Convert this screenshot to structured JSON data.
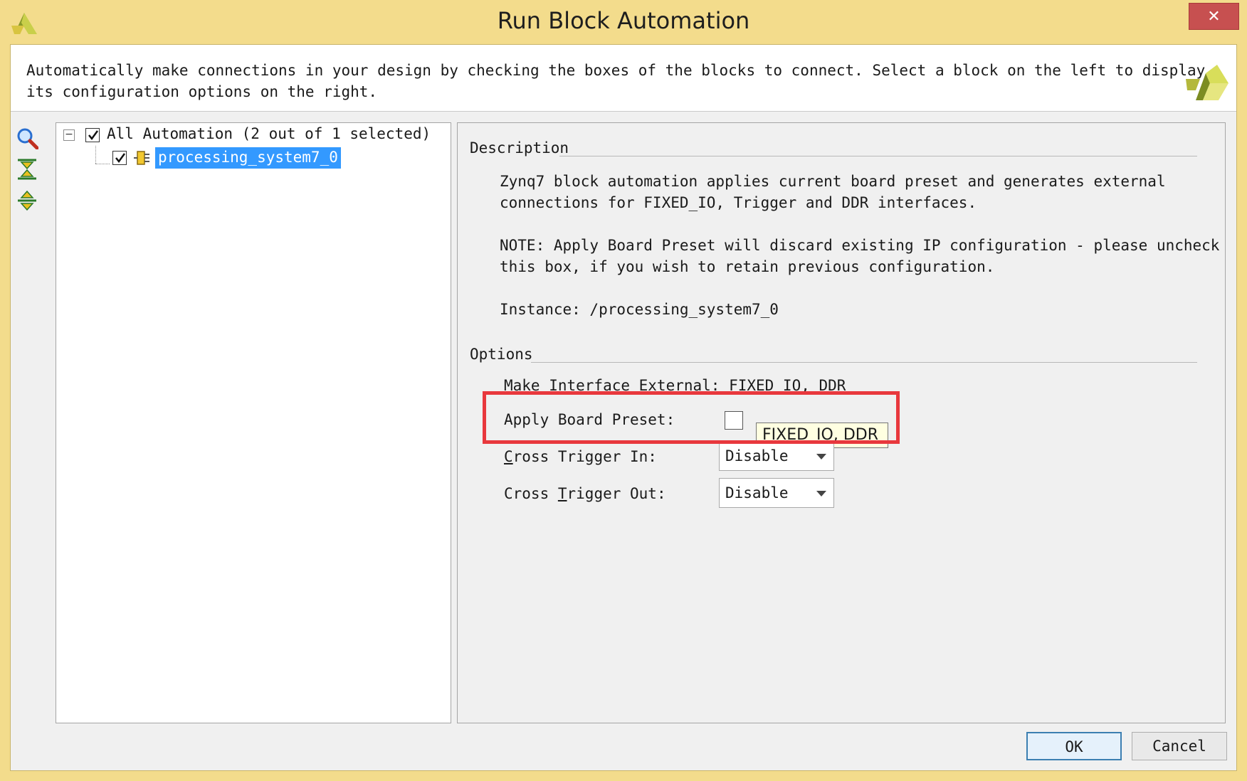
{
  "window": {
    "title": "Run Block Automation",
    "close_label": "✕"
  },
  "banner": {
    "line1": "Automatically make connections in your design by checking the boxes of the blocks to connect. Select a block on the left to display",
    "line2": "its configuration options on the right."
  },
  "toolbar": {
    "icons": [
      "search-icon",
      "collapse-all-icon",
      "expand-all-icon"
    ]
  },
  "tree": {
    "root": {
      "label": "All Automation (2 out of 1 selected)",
      "checked": true,
      "expander": "−"
    },
    "children": [
      {
        "label": "processing_system7_0",
        "checked": true,
        "selected": true
      }
    ]
  },
  "description": {
    "header": "Description",
    "para1_line1": "Zynq7 block automation applies current board preset and generates external",
    "para1_line2": "connections for FIXED_IO, Trigger and DDR interfaces.",
    "para2_line1": "NOTE: Apply Board Preset will discard existing IP configuration - please uncheck",
    "para2_line2": "this box, if you wish to retain previous configuration.",
    "instance": "Instance: /processing_system7_0"
  },
  "options": {
    "header": "Options",
    "make_external": "Make Interface External: FIXED_IO, DDR",
    "apply_board_preset_label": "Apply Board Preset:",
    "apply_board_preset_checked": false,
    "tooltip": "FIXED_IO, DDR",
    "cross_trigger_in_label": "Cross Trigger In:",
    "cross_trigger_in_value": "Disable",
    "cross_trigger_out_label": "Cross Trigger Out:",
    "cross_trigger_out_value": "Disable"
  },
  "buttons": {
    "ok": "OK",
    "cancel": "Cancel"
  },
  "colors": {
    "titlebar": "#f3dc8c",
    "selection": "#3399ff",
    "highlight_box": "#e8383d",
    "close_button": "#c75050"
  }
}
